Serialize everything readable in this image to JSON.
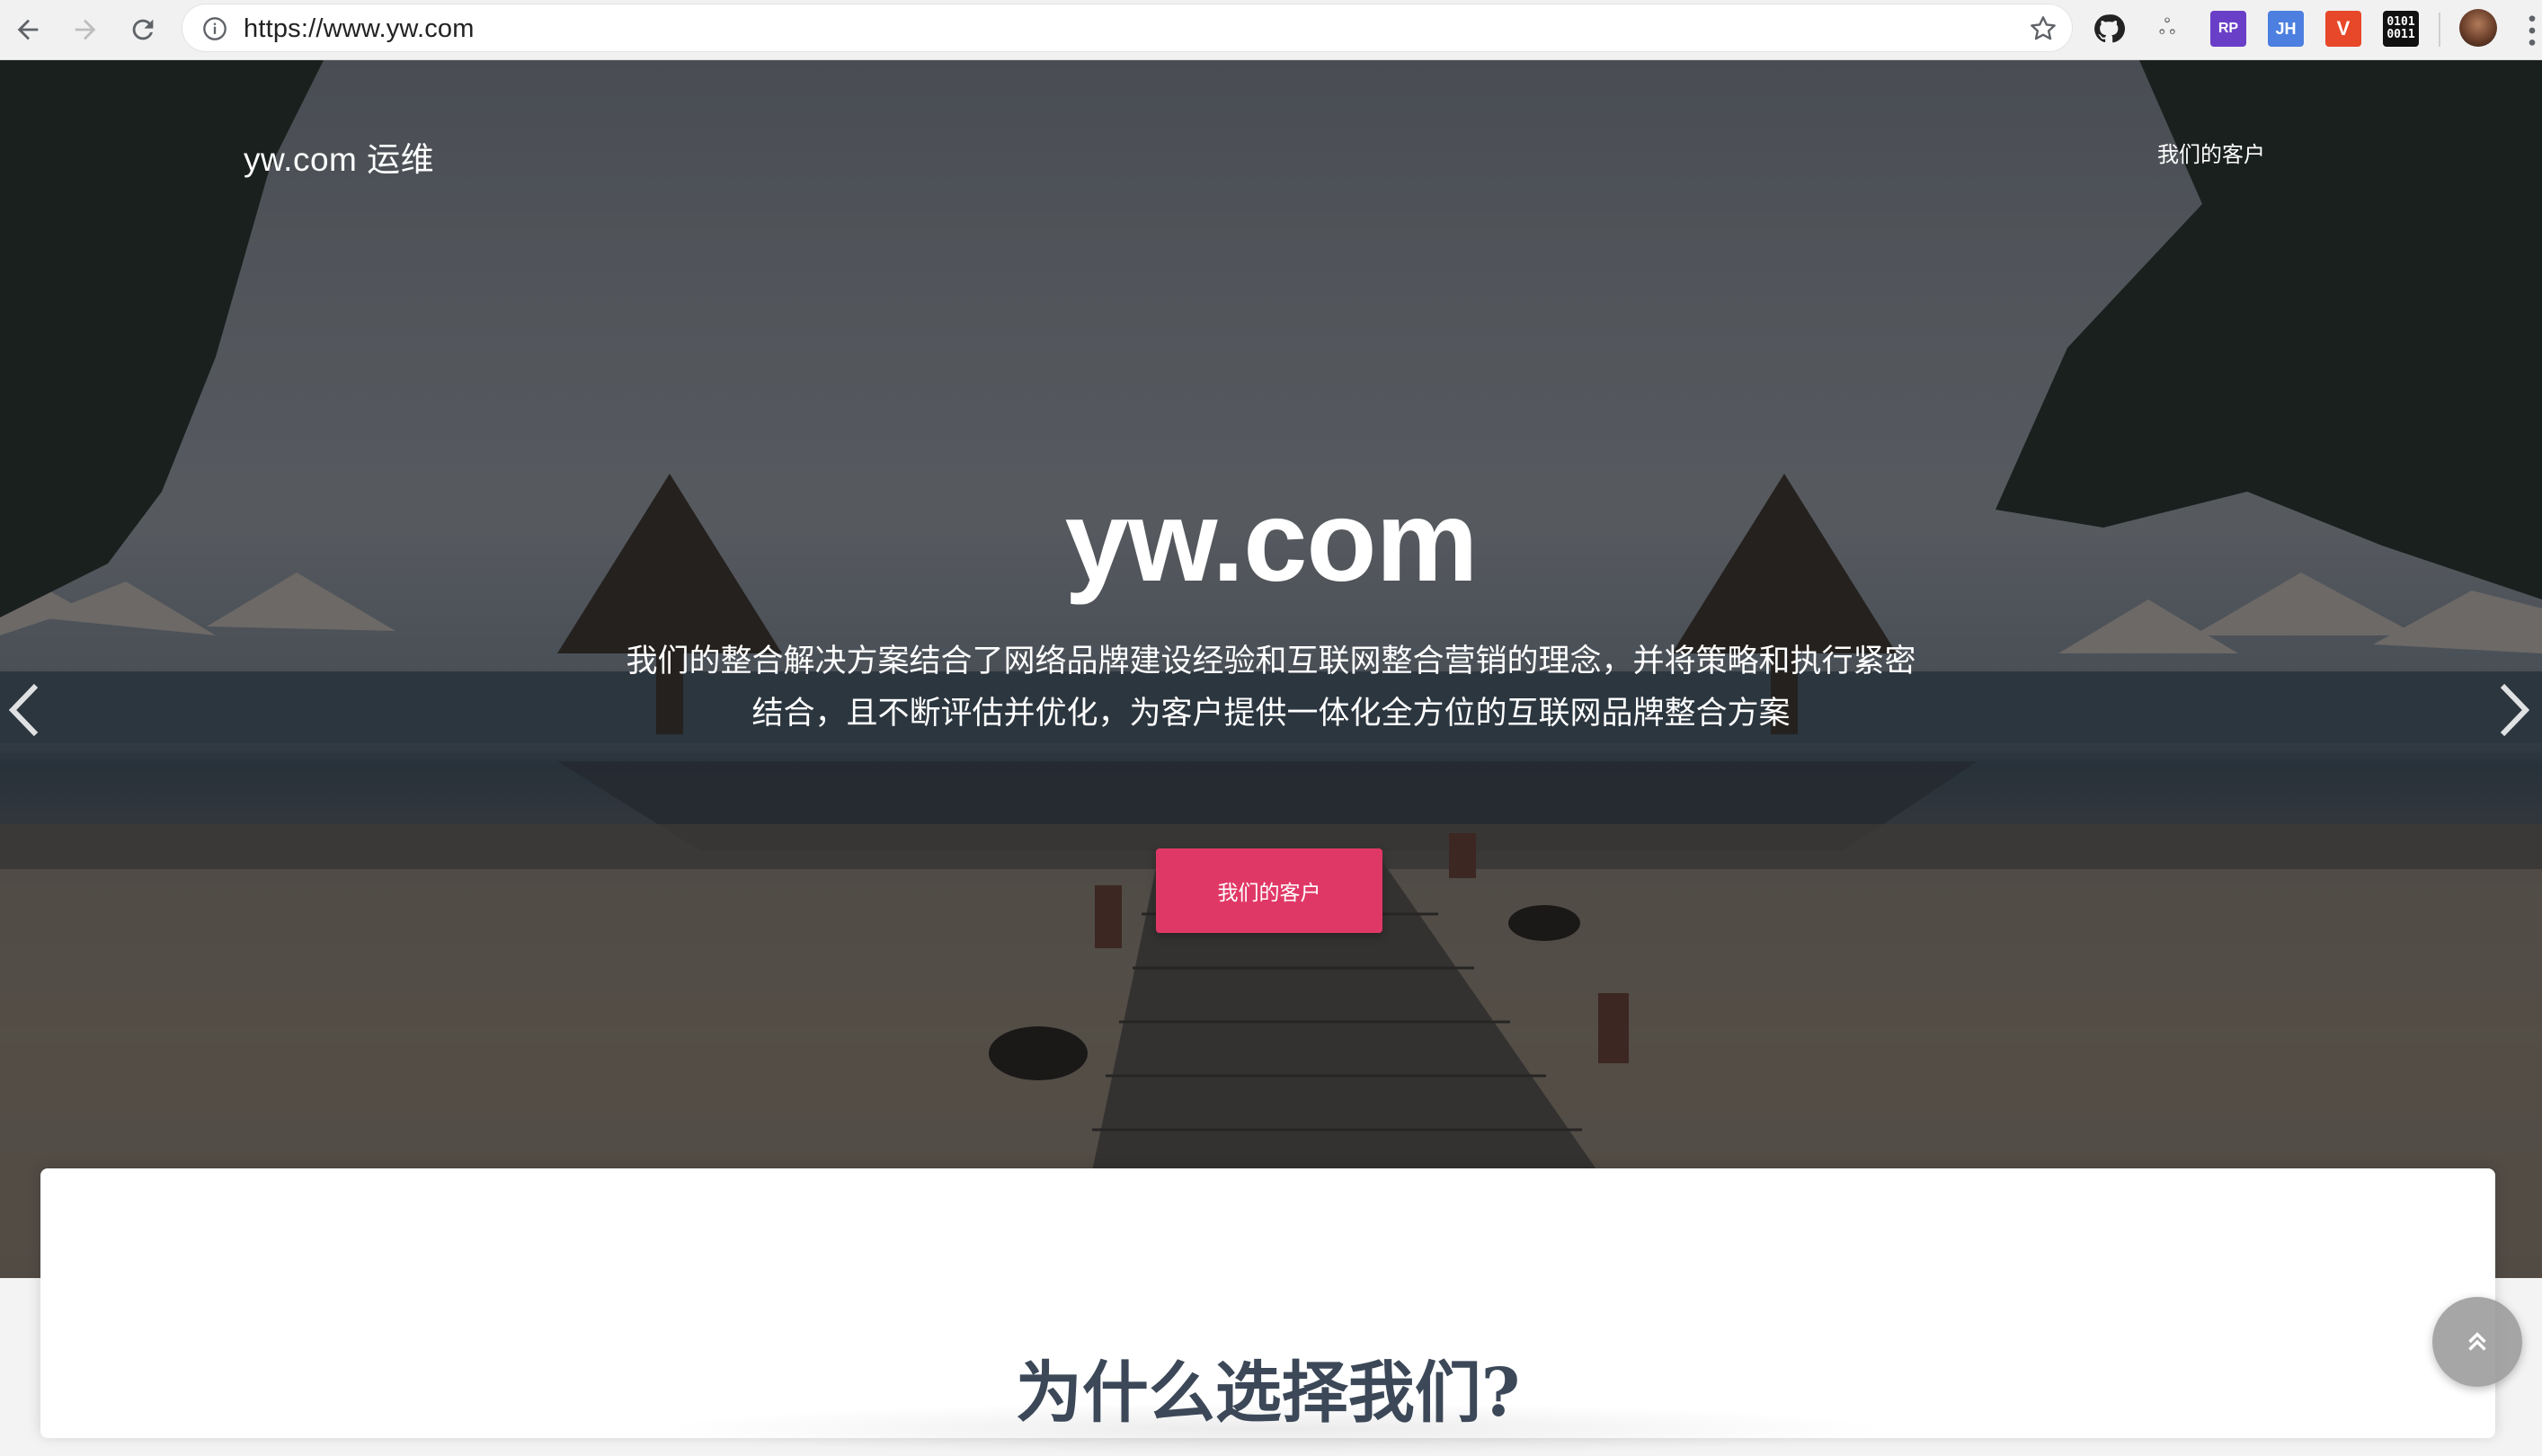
{
  "browser": {
    "url": "https://www.yw.com",
    "icons": {
      "back": "arrow-left-icon",
      "forward": "arrow-right-icon",
      "reload": "reload-icon",
      "info": "info-icon",
      "bookmark": "star-icon"
    },
    "extensions": [
      {
        "name": "github-octocat-icon",
        "label": ""
      },
      {
        "name": "tree-icon",
        "label": "ஃ"
      },
      {
        "name": "rp-extension-icon",
        "label": "RP"
      },
      {
        "name": "jh-extension-icon",
        "label": "JH"
      },
      {
        "name": "code-extension-icon",
        "label": "V̶"
      },
      {
        "name": "binary-extension-icon",
        "label": "0101\n0011"
      }
    ]
  },
  "site": {
    "brand": "yw.com 运维",
    "nav_link": "我们的客户"
  },
  "hero": {
    "title": "yw.com",
    "description": "我们的整合解决方案结合了网络品牌建设经验和互联网整合营销的理念，并将策略和执行紧密结合，且不断评估并优化，为客户提供一体化全方位的互联网品牌整合方案",
    "cta_label": "我们的客户",
    "accent_color": "#e03866"
  },
  "section": {
    "title": "为什么选择我们?"
  }
}
